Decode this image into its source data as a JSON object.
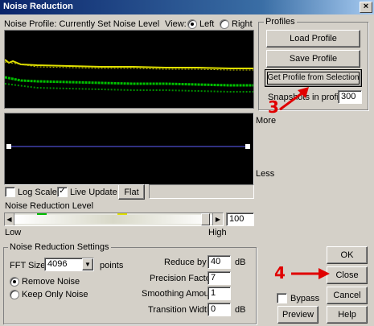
{
  "window": {
    "title": "Noise Reduction",
    "close_glyph": "×"
  },
  "profile": {
    "caption": "Noise Profile: Currently Set Noise Level",
    "view_label": "View:",
    "view_options": [
      "Left",
      "Right"
    ],
    "view_selected": "Left"
  },
  "curve": {
    "more_label": "More",
    "less_label": "Less"
  },
  "options": {
    "log_scale": "Log Scale",
    "log_scale_checked": false,
    "live_update": "Live Update",
    "live_update_checked": true,
    "flat_button": "Flat"
  },
  "reduction_level": {
    "label": "Noise Reduction Level",
    "low": "Low",
    "high": "High",
    "value": "100",
    "slider_fraction": 1.0
  },
  "settings": {
    "group_title": "Noise Reduction Settings",
    "fft_size_label": "FFT Size",
    "fft_size_value": "4096",
    "fft_size_unit": "points",
    "remove_noise": "Remove Noise",
    "keep_only_noise": "Keep Only Noise",
    "mode_selected": "Remove Noise",
    "reduce_by_label": "Reduce by",
    "reduce_by_value": "40",
    "reduce_by_unit": "dB",
    "precision_label": "Precision Factor",
    "precision_value": "7",
    "smoothing_label": "Smoothing Amount",
    "smoothing_value": "1",
    "transition_label": "Transition Width",
    "transition_value": "0",
    "transition_unit": "dB"
  },
  "profiles": {
    "group_title": "Profiles",
    "load": "Load Profile",
    "save": "Save Profile",
    "get_from_selection": "Get Profile from Selection",
    "snapshots_label": "Snapshots in profile",
    "snapshots_value": "300"
  },
  "buttons": {
    "ok": "OK",
    "close": "Close",
    "cancel": "Cancel",
    "bypass": "Bypass",
    "preview": "Preview",
    "help": "Help"
  },
  "annotations": {
    "step3": "3",
    "step4": "4"
  },
  "colors": {
    "noise_yellow": "#e0e000",
    "noise_green": "#00c000",
    "curve_line": "#6060ff",
    "annotation": "#e00000"
  }
}
